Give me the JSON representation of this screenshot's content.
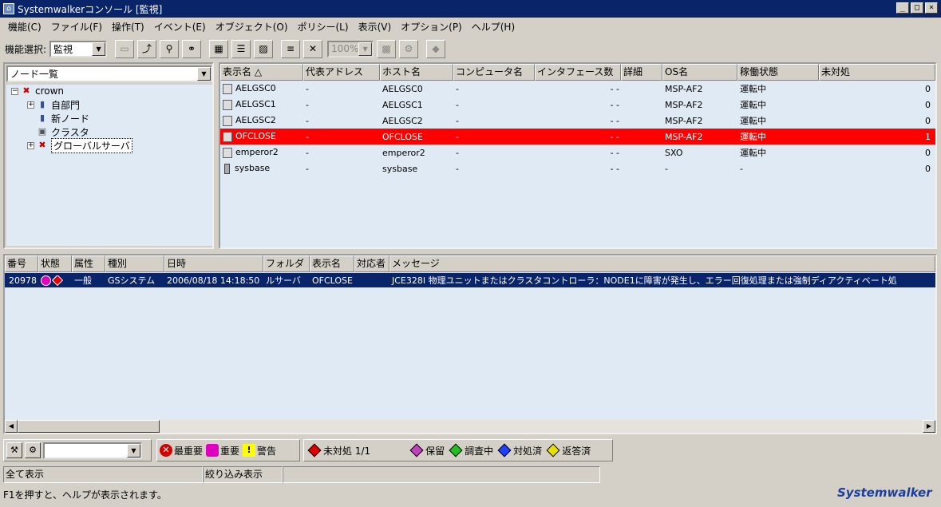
{
  "window": {
    "title": "Systemwalkerコンソール [監視]",
    "min_label": "_",
    "max_label": "□",
    "close_label": "×"
  },
  "menu": [
    "機能(C)",
    "ファイル(F)",
    "操作(T)",
    "イベント(E)",
    "オブジェクト(O)",
    "ポリシー(L)",
    "表示(V)",
    "オプション(P)",
    "ヘルプ(H)"
  ],
  "toolbar": {
    "function_label": "機能選択:",
    "function_value": "監視",
    "zoom_value": "100%"
  },
  "tree": {
    "selector": "ノード一覧",
    "root": "crown",
    "nodes": [
      "自部門",
      "新ノード",
      "クラスタ",
      "グローバルサーバ"
    ]
  },
  "node_table": {
    "headers": [
      "表示名 △",
      "代表アドレス",
      "ホスト名",
      "コンピュータ名",
      "インタフェース数",
      "詳細",
      "OS名",
      "稼働状態",
      "未対処"
    ],
    "rows": [
      [
        "AELGSC0",
        "-",
        "AELGSC0",
        "-",
        "- -",
        "",
        "MSP-AF2",
        "運転中",
        "0"
      ],
      [
        "AELGSC1",
        "-",
        "AELGSC1",
        "-",
        "- -",
        "",
        "MSP-AF2",
        "運転中",
        "0"
      ],
      [
        "AELGSC2",
        "-",
        "AELGSC2",
        "-",
        "- -",
        "",
        "MSP-AF2",
        "運転中",
        "0"
      ],
      [
        "OFCLOSE",
        "-",
        "OFCLOSE",
        "-",
        "- -",
        "",
        "MSP-AF2",
        "運転中",
        "1"
      ],
      [
        "emperor2",
        "-",
        "emperor2",
        "-",
        "- -",
        "",
        "SXO",
        "運転中",
        "0"
      ],
      [
        "sysbase",
        "-",
        "sysbase",
        "-",
        "- -",
        "",
        "-",
        "-",
        "0"
      ]
    ],
    "highlight_row": 3,
    "highlight_color": "#ff0000"
  },
  "event_table": {
    "headers": [
      "番号",
      "状態",
      "属性",
      "種別",
      "日時",
      "フォルダ",
      "表示名",
      "対応者",
      "メッセージ"
    ],
    "rows": [
      [
        "20978",
        "",
        "一般",
        "GSシステム",
        "2006/08/18 14:18:50",
        "ルサーバ",
        "OFCLOSE",
        "",
        "JCE328I 物理ユニットまたはクラスタコントローラ：NODE1に障害が発生し、エラー回復処理または強制ディアクティベート処"
      ]
    ]
  },
  "filter": {
    "severity": [
      {
        "label": "最重要",
        "icon": "critical-icon",
        "color": "#d40000"
      },
      {
        "label": "重要",
        "icon": "important-icon",
        "color": "#e000c0"
      },
      {
        "label": "警告",
        "icon": "warning-icon",
        "color": "#ffff00"
      }
    ],
    "unhandled": "未対処 1/1",
    "statuses": [
      {
        "label": "保留",
        "color": "#c040c0"
      },
      {
        "label": "調査中",
        "color": "#20c020"
      },
      {
        "label": "対処済",
        "color": "#2040ff"
      },
      {
        "label": "返答済",
        "color": "#e8e000"
      }
    ]
  },
  "statusbar": {
    "all": "全て表示",
    "filter": "絞り込み表示",
    "extra": ""
  },
  "help_text": "F1を押すと、ヘルプが表示されます。",
  "brand": "Systemwalker"
}
